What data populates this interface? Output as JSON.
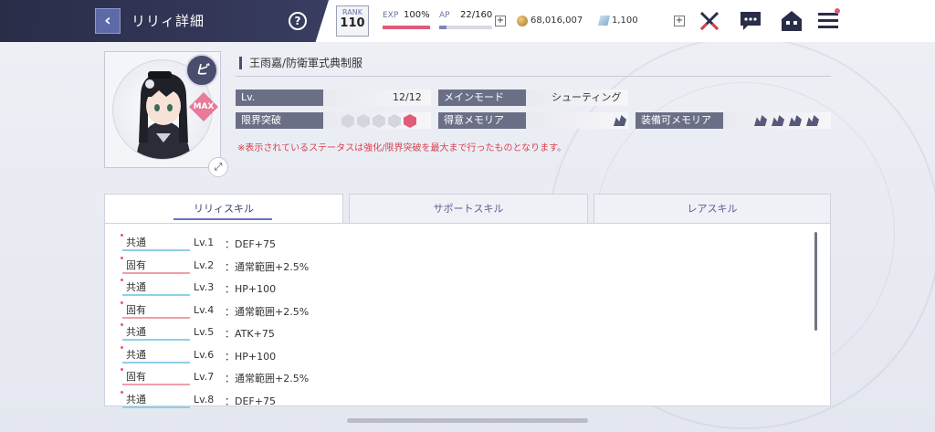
{
  "header": {
    "back_icon": "chevron-left-icon",
    "title": "リリィ詳細",
    "help_label": "?",
    "rank_label": "RANK",
    "rank_value": "110",
    "exp_label": "EXP",
    "exp_value": "100%",
    "exp_fill": 1.0,
    "ap_label": "AP",
    "ap_value": "22/160",
    "ap_fill": 0.1375,
    "plus": "+",
    "gold_value": "68,016,007",
    "gem_value": "1,100",
    "icons": [
      "swords-icon",
      "chat-icon",
      "home-icon",
      "menu-icon"
    ]
  },
  "character": {
    "name": "王雨嘉/防衛軍式典制服",
    "type_badge": "ビ",
    "max_badge": "MAX",
    "expand_icon": "expand-icon"
  },
  "info": {
    "lv_label": "Lv.",
    "lv_value": "12/12",
    "main_mode_label": "メインモード",
    "main_mode_value": "シューティング",
    "limit_break_label": "限界突破",
    "limit_break_steps": 5,
    "limit_break_filled": 1,
    "specialty_label": "得意メモリア",
    "equip_label": "装備可メモリア",
    "notice": "※表示されているステータスは強化/限界突破を最大まで行ったものとなります。"
  },
  "tabs": [
    {
      "label": "リリィスキル",
      "active": true
    },
    {
      "label": "サポートスキル",
      "active": false
    },
    {
      "label": "レアスキル",
      "active": false
    }
  ],
  "skills": [
    {
      "tag": "共通",
      "kind": "common",
      "lv": "Lv.1",
      "desc": "：DEF+75"
    },
    {
      "tag": "固有",
      "kind": "unique",
      "lv": "Lv.2",
      "desc": "：通常範囲+2.5%"
    },
    {
      "tag": "共通",
      "kind": "common",
      "lv": "Lv.3",
      "desc": "：HP+100"
    },
    {
      "tag": "固有",
      "kind": "unique",
      "lv": "Lv.4",
      "desc": "：通常範囲+2.5%"
    },
    {
      "tag": "共通",
      "kind": "common",
      "lv": "Lv.5",
      "desc": "：ATK+75"
    },
    {
      "tag": "共通",
      "kind": "common",
      "lv": "Lv.6",
      "desc": "：HP+100"
    },
    {
      "tag": "固有",
      "kind": "unique",
      "lv": "Lv.7",
      "desc": "：通常範囲+2.5%"
    },
    {
      "tag": "共通",
      "kind": "common",
      "lv": "Lv.8",
      "desc": "：DEF+75"
    }
  ]
}
